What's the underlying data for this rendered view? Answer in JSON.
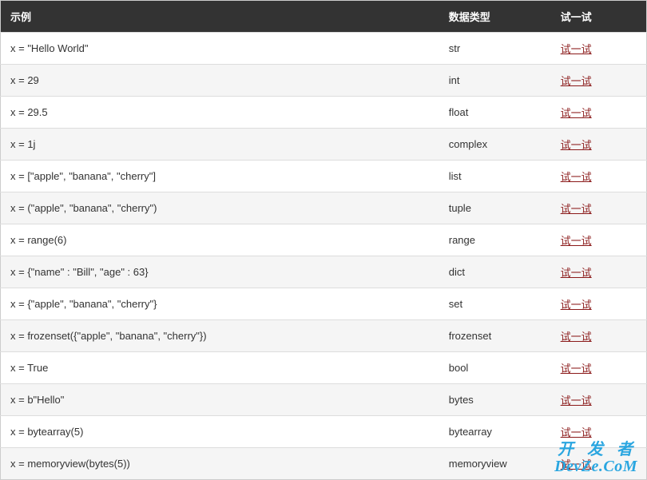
{
  "table": {
    "headers": {
      "example": "示例",
      "type": "数据类型",
      "try": "试一试"
    },
    "try_link_text": "试一试",
    "rows": [
      {
        "example": "x = \"Hello World\"",
        "type": "str"
      },
      {
        "example": "x = 29",
        "type": "int"
      },
      {
        "example": "x = 29.5",
        "type": "float"
      },
      {
        "example": "x = 1j",
        "type": "complex"
      },
      {
        "example": "x = [\"apple\", \"banana\", \"cherry\"]",
        "type": "list"
      },
      {
        "example": "x = (\"apple\", \"banana\", \"cherry\")",
        "type": "tuple"
      },
      {
        "example": "x = range(6)",
        "type": "range"
      },
      {
        "example": "x = {\"name\" : \"Bill\", \"age\" : 63}",
        "type": "dict"
      },
      {
        "example": "x = {\"apple\", \"banana\", \"cherry\"}",
        "type": "set"
      },
      {
        "example": "x = frozenset({\"apple\", \"banana\", \"cherry\"})",
        "type": "frozenset"
      },
      {
        "example": "x = True",
        "type": "bool"
      },
      {
        "example": "x = b\"Hello\"",
        "type": "bytes"
      },
      {
        "example": "x = bytearray(5)",
        "type": "bytearray"
      },
      {
        "example": "x = memoryview(bytes(5))",
        "type": "memoryview"
      }
    ]
  },
  "watermark": {
    "line1": "开 发 者",
    "line2": "DevZe.CoM"
  }
}
